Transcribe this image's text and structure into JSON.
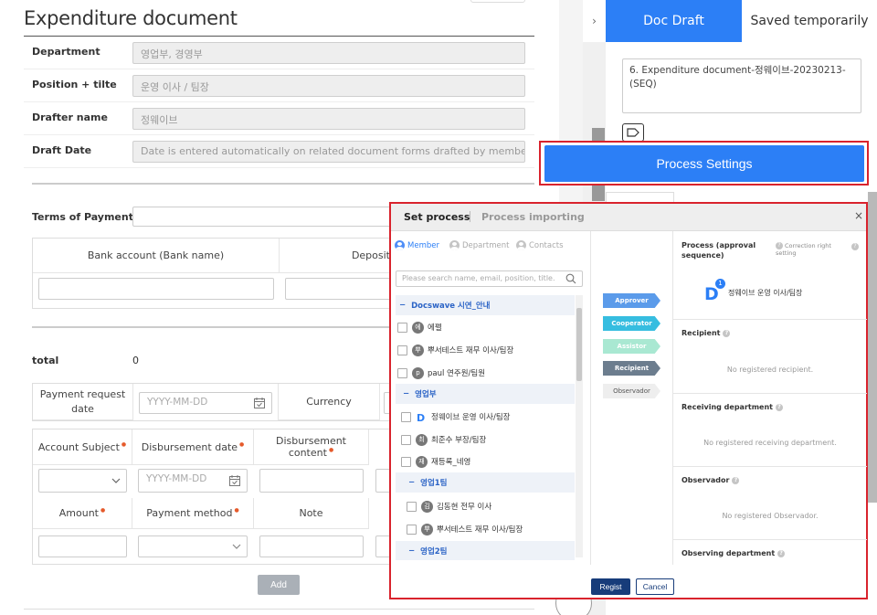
{
  "document": {
    "title": "Expenditure document",
    "fields": [
      {
        "label": "Department",
        "value": "영업부, 경영부"
      },
      {
        "label": "Position + tilte",
        "value": "운영 이사 / 팀장"
      },
      {
        "label": "Drafter name",
        "value": "정웨이브"
      },
      {
        "label": "Draft Date",
        "value": "Date is entered automatically on related document forms drafted by members."
      }
    ],
    "terms_of_payment_label": "Terms of Payment",
    "bank_table": {
      "col1": "Bank account (Bank name)",
      "col2": "Deposit"
    },
    "total_label": "total",
    "total_value": "0",
    "payment_request_date_label": "Payment request date",
    "date_placeholder": "YYYY-MM-DD",
    "currency_label": "Currency",
    "items_table": {
      "account_subject": "Account Subject",
      "disbursement_date": "Disbursement date",
      "disbursement_content": "Disbursement content",
      "amount": "Amount",
      "payment_method": "Payment method",
      "note": "Note"
    },
    "add_label": "Add"
  },
  "right_panel": {
    "collapse_glyph": "›",
    "tab_doc_draft": "Doc Draft",
    "tab_saved": "Saved temporarily",
    "document_name": "6. Expenditure document-정웨이브-20230213-(SEQ)",
    "process_settings_label": "Process Settings"
  },
  "modal": {
    "tab_set_process": "Set process",
    "tab_process_importing": "Process importing",
    "close_glyph": "×",
    "source_tabs": {
      "member": "Member",
      "department": "Department",
      "contacts": "Contacts"
    },
    "search_placeholder": "Please search name, email, position, title.",
    "tree": [
      {
        "type": "group",
        "label": "Docswave 시연_안내",
        "prefix": "−"
      },
      {
        "type": "member",
        "avatar": "에",
        "label": "에펠"
      },
      {
        "type": "member",
        "avatar": "뿌",
        "label": "뿌서테스트 재무 이사/팀장"
      },
      {
        "type": "member",
        "avatar": "p",
        "label": "paul 연주원/팀원"
      },
      {
        "type": "group",
        "label": "영업부",
        "prefix": "−"
      },
      {
        "type": "member",
        "avatar": "D",
        "label": "정웨이브 운영 이사/팀장"
      },
      {
        "type": "member",
        "avatar": "최",
        "label": "최준수 부장/팀장"
      },
      {
        "type": "member",
        "avatar": "재",
        "label": "재등록_네영"
      },
      {
        "type": "group",
        "label": "영업1팀",
        "prefix": "−"
      },
      {
        "type": "member",
        "avatar": "김",
        "label": "김동현 전무 이사"
      },
      {
        "type": "member",
        "avatar": "뿌",
        "label": "뿌서테스트 재무 이사/팀장"
      },
      {
        "type": "group",
        "label": "영업2팀",
        "prefix": "−"
      }
    ],
    "roles": [
      {
        "label": "Approver",
        "color": "#5b9bea"
      },
      {
        "label": "Cooperator",
        "color": "#36bde0"
      },
      {
        "label": "Assistor",
        "color": "#a9e8d2"
      },
      {
        "label": "Recipient",
        "color": "#6c7d8e"
      },
      {
        "label": "Observador",
        "color": "#eeeeee"
      }
    ],
    "process_title": "Process (approval sequence)",
    "correction_right_setting": "Correction right setting",
    "approver_badge": "1",
    "approver_name": "정웨이브 운영 이사/팀장",
    "sections": [
      {
        "title": "Recipient",
        "empty": "No registered recipient."
      },
      {
        "title": "Receiving department",
        "empty": "No registered receiving department."
      },
      {
        "title": "Observador",
        "empty": "No registered Observador."
      },
      {
        "title": "Observing department",
        "empty": ""
      }
    ],
    "regist_label": "Regist",
    "cancel_label": "Cancel"
  }
}
